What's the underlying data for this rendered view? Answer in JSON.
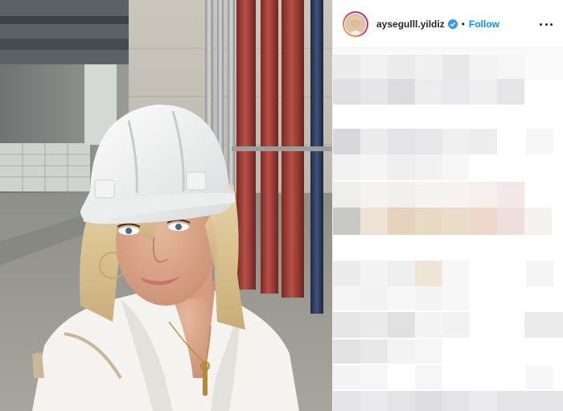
{
  "post": {
    "username": "aysegulll.yildiz",
    "separator": "•",
    "follow_label": "Follow",
    "verified": true,
    "more_icon": "ellipsis-horizontal-icon",
    "verified_icon": "verified-badge-icon"
  },
  "photo": {
    "subject": "selfie of woman in white hard hat at construction site"
  },
  "colors": {
    "follow_blue": "#0095f6",
    "text": "#262626",
    "border": "#efefef"
  }
}
